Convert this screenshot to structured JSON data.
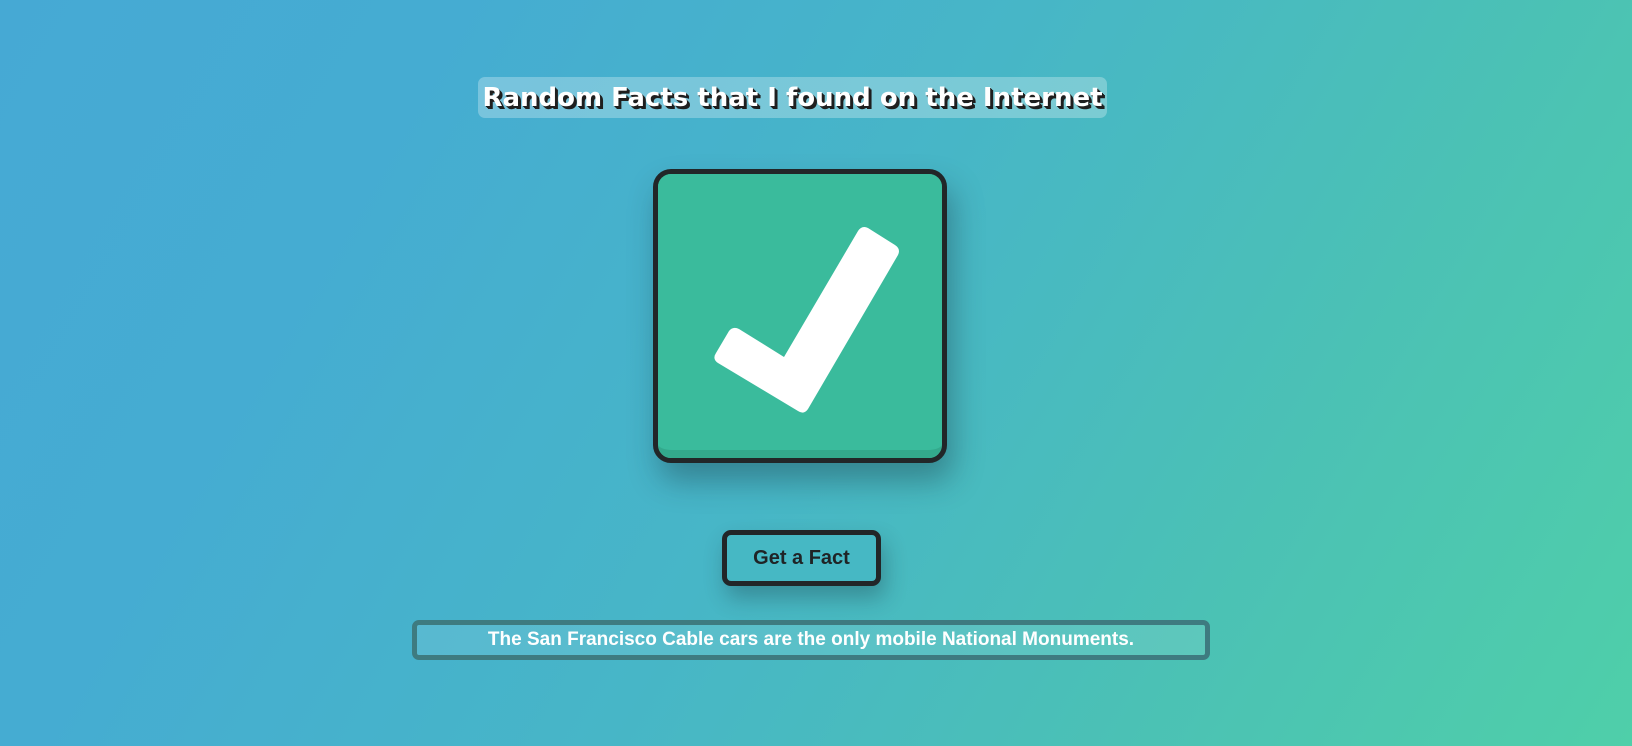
{
  "header": {
    "title": "Random Facts that I found on the Internet"
  },
  "status_card": {
    "icon": "checkmark-icon",
    "colors": {
      "card": "#3abb9c",
      "border": "#222628",
      "check": "#ffffff"
    }
  },
  "actions": {
    "get_fact_label": "Get a Fact"
  },
  "fact": {
    "text": "The San Francisco Cable cars are the only mobile National Monuments."
  }
}
